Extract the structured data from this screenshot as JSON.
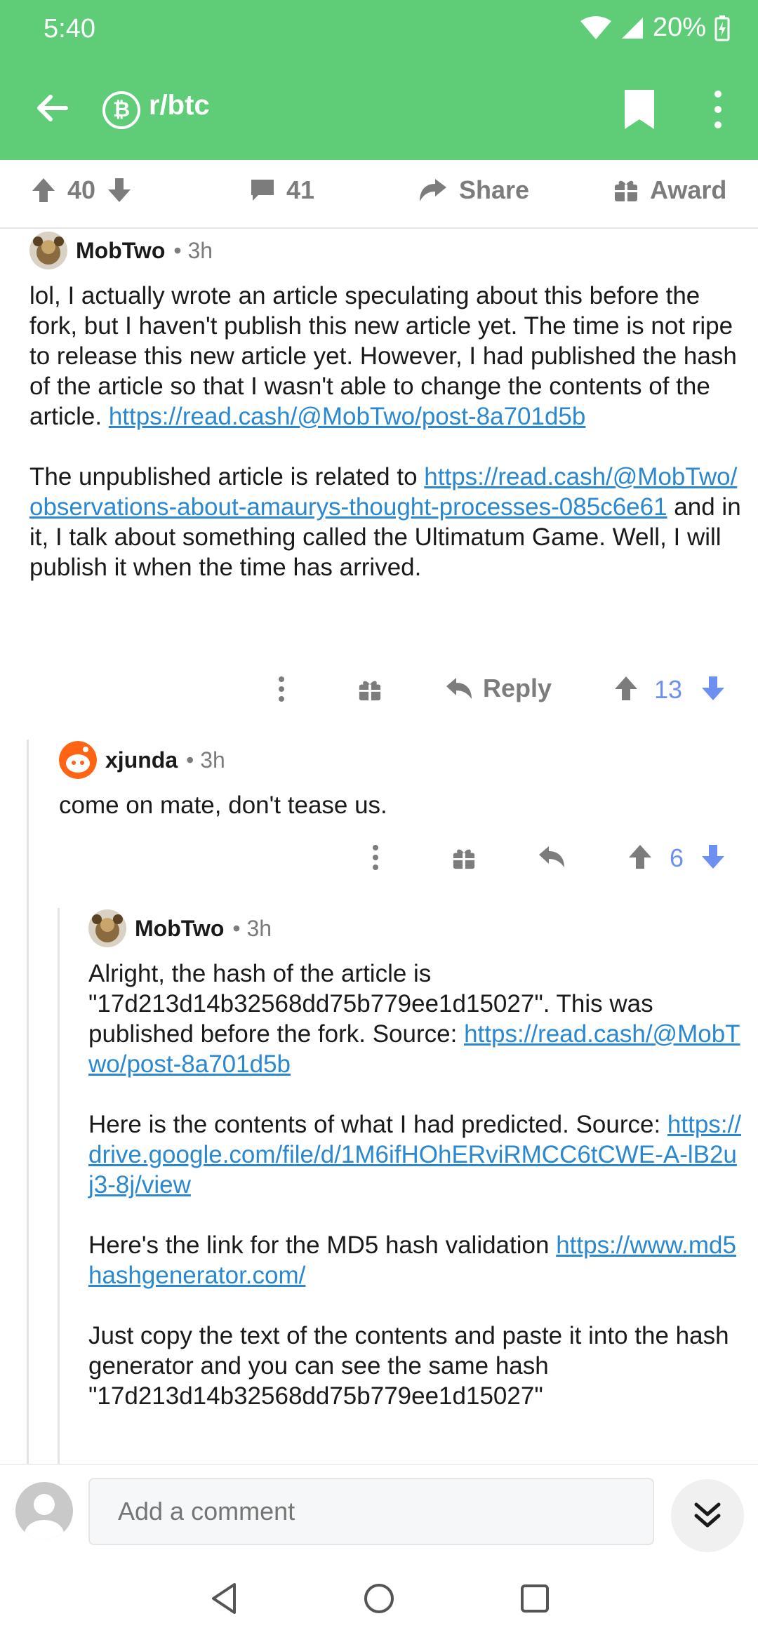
{
  "status_bar": {
    "time": "5:40",
    "battery": "20%"
  },
  "header": {
    "subreddit": "r/btc",
    "sub_icon_glyph": "₿",
    "color": "#5fcd78"
  },
  "post_actions": {
    "upvotes": "40",
    "comments": "41",
    "share_label": "Share",
    "award_label": "Award"
  },
  "comments": [
    {
      "author": "MobTwo",
      "meta": "• 3h",
      "paragraphs": [
        {
          "text_before": "lol, I actually wrote an article speculating about this before the fork, but I haven't publish this new article yet. The time is not ripe to release this new article yet. However, I had published the hash of the article so that I wasn't able to change the contents of the article. ",
          "link": "https://read.cash/@MobTwo/post-8a701d5b",
          "text_after": ""
        },
        {
          "text_before": "The unpublished article is related to ",
          "link": "https://read.cash/@MobTwo/observations-about-amaurys-thought-processes-085c6e61",
          "text_after": " and in it, I talk about something called the Ultimatum Game. Well, I will publish it when the time has arrived."
        }
      ],
      "reply_label": "Reply",
      "score": "13"
    },
    {
      "author": "xjunda",
      "meta": "• 3h",
      "text": "come on mate, don't tease us.",
      "score": "6"
    },
    {
      "author": "MobTwo",
      "meta": "• 3h",
      "p1_before": "Alright, the hash of the article is \"17d213d14b32568dd75b779ee1d15027\". This was published before the fork. Source: ",
      "p1_link": "https://read.cash/@MobTwo/post-8a701d5b",
      "p2_before": "Here is the contents of what I had predicted. Source: ",
      "p2_link": "https://drive.google.com/file/d/1M6ifHOhERviRMCC6tCWE-A-lB2uj3-8j/view",
      "p3_before": "Here's the link for the MD5 hash validation ",
      "p3_link": "https://www.md5hashgenerator.com/",
      "p4": "Just copy the text of the contents and paste it into the hash generator and you can see the same hash \"17d213d14b32568dd75b779ee1d15027\""
    }
  ],
  "comment_bar": {
    "placeholder": "Add a comment"
  },
  "icons": {
    "back": "back-arrow-icon",
    "bookmark": "bookmark-icon",
    "more": "more-vertical-icon",
    "upvote": "upvote-arrow-icon",
    "downvote": "downvote-arrow-icon",
    "comment": "comment-bubble-icon",
    "share": "share-arrow-icon",
    "award": "gift-icon",
    "reply": "reply-arrow-icon",
    "jump": "double-chevron-down-icon"
  },
  "colors": {
    "link": "#2a88d1",
    "vote_active": "#6d8ff0",
    "muted": "#7c7c7c"
  }
}
